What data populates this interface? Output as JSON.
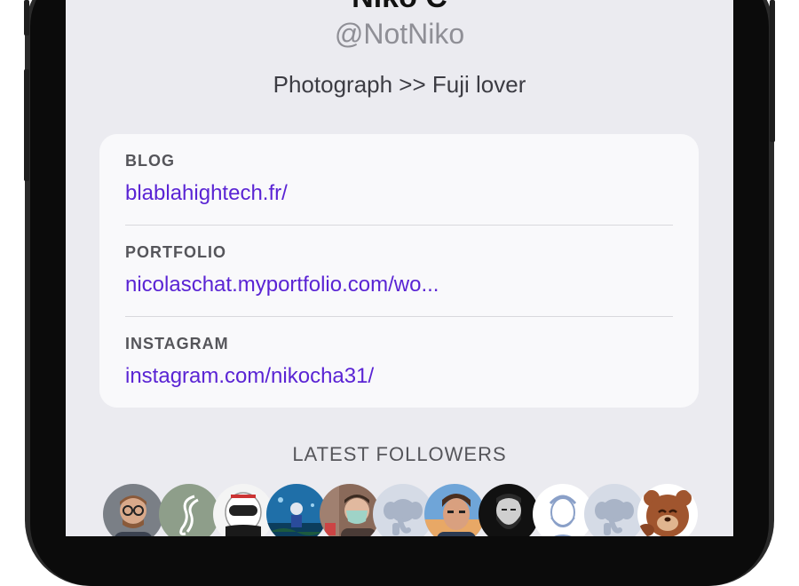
{
  "profile": {
    "name": "Niko C",
    "handle": "@NotNiko",
    "bio": "Photograph >> Fuji lover"
  },
  "links": [
    {
      "label": "BLOG",
      "url": "blablahightech.fr/"
    },
    {
      "label": "PORTFOLIO",
      "url": "nicolaschat.myportfolio.com/wo..."
    },
    {
      "label": "INSTAGRAM",
      "url": "instagram.com/nikocha31/"
    }
  ],
  "followers": {
    "title": "LATEST FOLLOWERS",
    "avatars": [
      "man-with-glasses",
      "pinch-logo",
      "motorcycle-helmet",
      "aquarium-diver",
      "masked-person",
      "default-elephant",
      "selfie-man",
      "bearded-man",
      "sketch-portrait",
      "default-elephant",
      "cartoon-bear"
    ]
  },
  "colors": {
    "accent": "#5a24d4",
    "background": "#ebebf0",
    "card": "#f9f9fb"
  }
}
